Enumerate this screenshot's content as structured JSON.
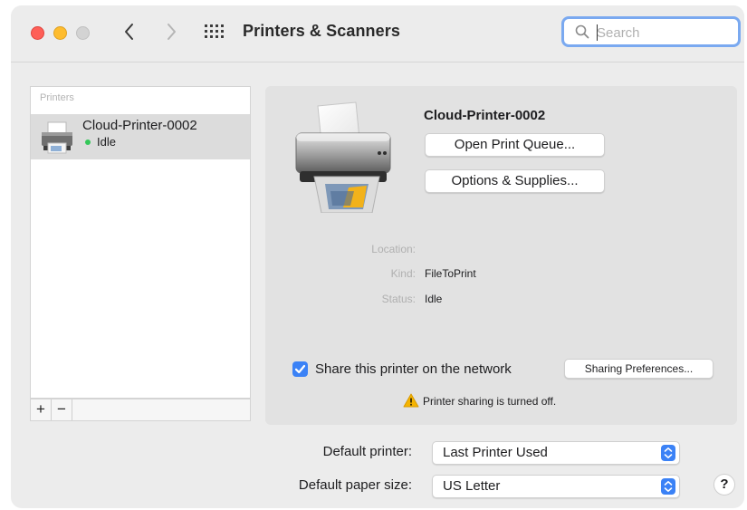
{
  "window": {
    "title": "Printers & Scanners",
    "search": {
      "placeholder": "Search",
      "value": ""
    }
  },
  "printers_list": {
    "header": "Printers",
    "items": [
      {
        "name": "Cloud-Printer-0002",
        "status": "Idle",
        "status_color": "#34c759"
      }
    ],
    "add_label": "+",
    "remove_label": "−"
  },
  "detail": {
    "printer_name": "Cloud-Printer-0002",
    "open_queue_label": "Open Print Queue...",
    "options_label": "Options & Supplies...",
    "info": {
      "location_label": "Location:",
      "location_value": "",
      "kind_label": "Kind:",
      "kind_value": "FileToPrint",
      "status_label": "Status:",
      "status_value": "Idle"
    },
    "share_label": "Share this printer on the network",
    "share_checked": true,
    "sharing_prefs_label": "Sharing Preferences...",
    "sharing_warning": "Printer sharing is turned off."
  },
  "defaults": {
    "printer_label": "Default printer:",
    "printer_value": "Last Printer Used",
    "paper_label": "Default paper size:",
    "paper_value": "US Letter"
  },
  "help_label": "?",
  "colors": {
    "accent": "#3b82f6",
    "idle_dot": "#34c759",
    "warning": "#f5b400"
  }
}
